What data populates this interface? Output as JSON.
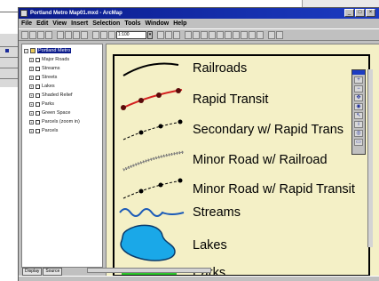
{
  "window": {
    "title": "Portland Metro Map01.mxd - ArcMap",
    "controls": [
      "_",
      "□",
      "×"
    ]
  },
  "menu": [
    "File",
    "Edit",
    "View",
    "Insert",
    "Selection",
    "Tools",
    "Window",
    "Help"
  ],
  "toolbar": {
    "scale": "1:100"
  },
  "toc": {
    "root": "Portland Metro",
    "layers": [
      "Major Roads",
      "Streams",
      "Streets",
      "Lakes",
      "Shaded Relief",
      "Parks",
      "Green Space",
      "Parcels (zoom in)",
      "Parcels"
    ],
    "tabs": [
      "Display",
      "Source"
    ]
  },
  "legend": {
    "items": [
      {
        "label": "Railroads",
        "symbol": "railroad-line"
      },
      {
        "label": "Rapid Transit",
        "symbol": "rapid-transit-line"
      },
      {
        "label": "Secondary w/ Rapid Trans",
        "symbol": "secondary-road-line"
      },
      {
        "label": "Minor Road w/ Railroad",
        "symbol": "minor-road-railroad-line"
      },
      {
        "label": "Minor Road w/ Rapid Transit",
        "symbol": "minor-road-transit-line"
      },
      {
        "label": "Streams",
        "symbol": "stream-line"
      },
      {
        "label": "Lakes",
        "symbol": "lake-polygon"
      },
      {
        "label": "Parks",
        "symbol": "park-polygon"
      }
    ]
  },
  "colors": {
    "map_background": "#f4f0c6",
    "rapid_transit": "#d42020",
    "streams": "#1a5ab8",
    "lakes": "#1aa8e8",
    "parks": "#2ec82e",
    "title_bar": "#0a1a8a"
  }
}
